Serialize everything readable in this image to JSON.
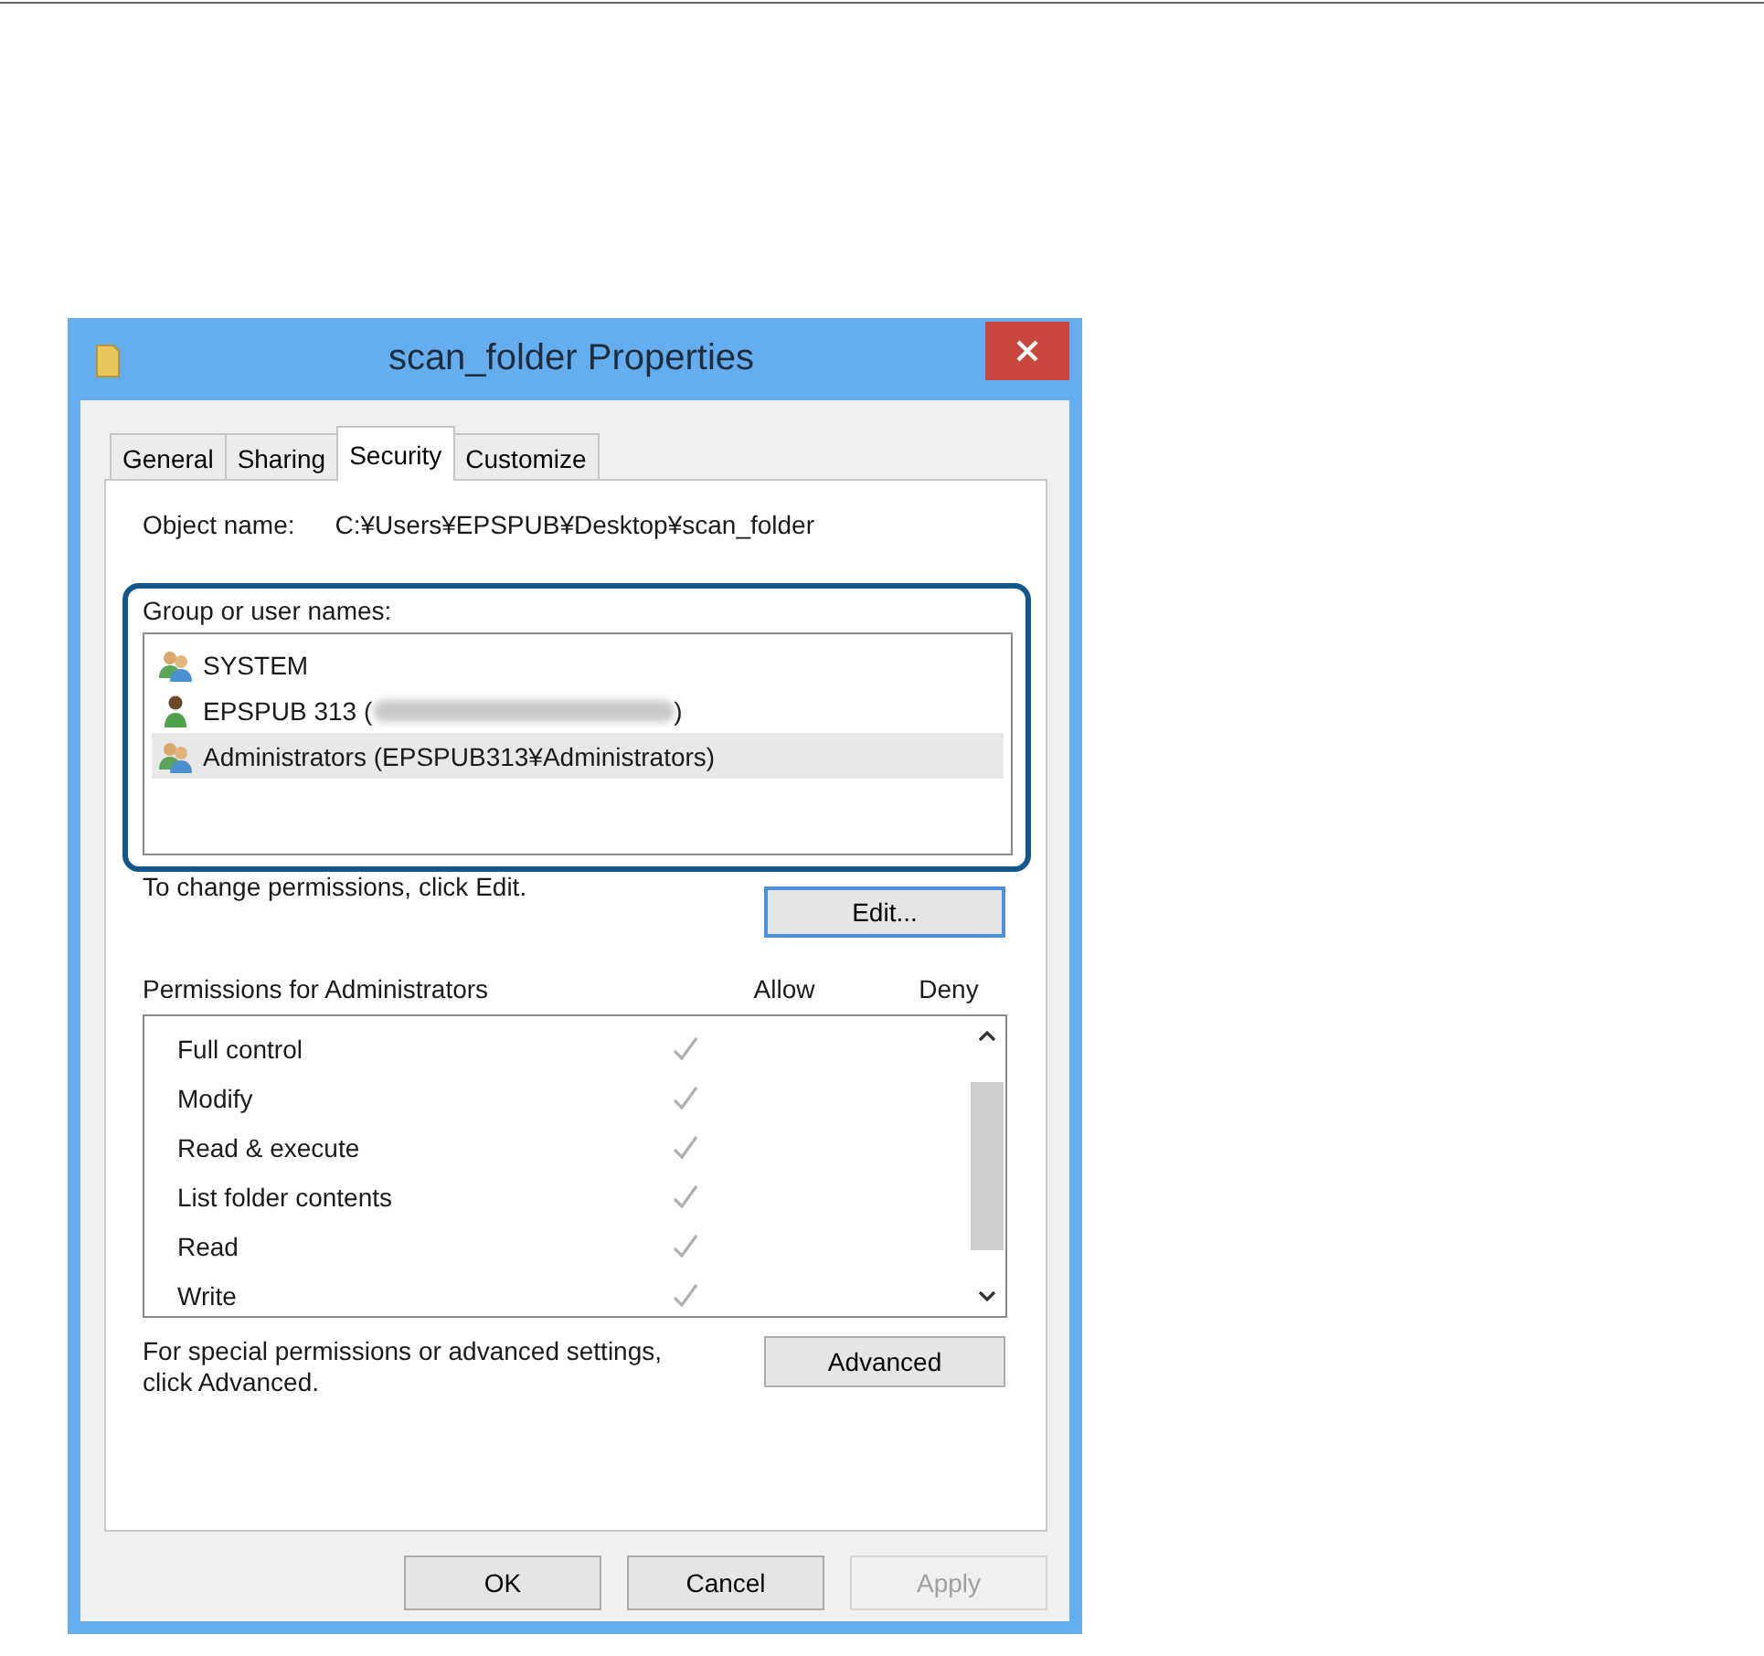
{
  "window": {
    "title": "scan_folder Properties"
  },
  "tabs": [
    {
      "label": "General",
      "selected": false
    },
    {
      "label": "Sharing",
      "selected": false
    },
    {
      "label": "Security",
      "selected": true
    },
    {
      "label": "Customize",
      "selected": false
    }
  ],
  "object_name": {
    "label": "Object name:",
    "value": "C:¥Users¥EPSPUB¥Desktop¥scan_folder"
  },
  "group_list": {
    "label": "Group or user names:",
    "highlighted": true,
    "items": [
      {
        "kind": "group",
        "name": "SYSTEM",
        "selected": false
      },
      {
        "kind": "user",
        "name": "EPSPUB 313 (",
        "redacted": true,
        "suffix": ")",
        "selected": false
      },
      {
        "kind": "group",
        "name": "Administrators (EPSPUB313¥Administrators)",
        "selected": true
      }
    ]
  },
  "change_hint": "To change permissions, click Edit.",
  "edit_button": "Edit...",
  "permissions": {
    "label": "Permissions for Administrators",
    "columns": [
      "Allow",
      "Deny"
    ],
    "rows": [
      {
        "name": "Full control",
        "allow": true,
        "deny": false
      },
      {
        "name": "Modify",
        "allow": true,
        "deny": false
      },
      {
        "name": "Read & execute",
        "allow": true,
        "deny": false
      },
      {
        "name": "List folder contents",
        "allow": true,
        "deny": false
      },
      {
        "name": "Read",
        "allow": true,
        "deny": false
      },
      {
        "name": "Write",
        "allow": true,
        "deny": false
      }
    ]
  },
  "advanced_hint": "For special permissions or advanced settings, click Advanced.",
  "advanced_button": "Advanced",
  "buttons": [
    {
      "label": "OK",
      "disabled": false
    },
    {
      "label": "Cancel",
      "disabled": false
    },
    {
      "label": "Apply",
      "disabled": true
    }
  ]
}
